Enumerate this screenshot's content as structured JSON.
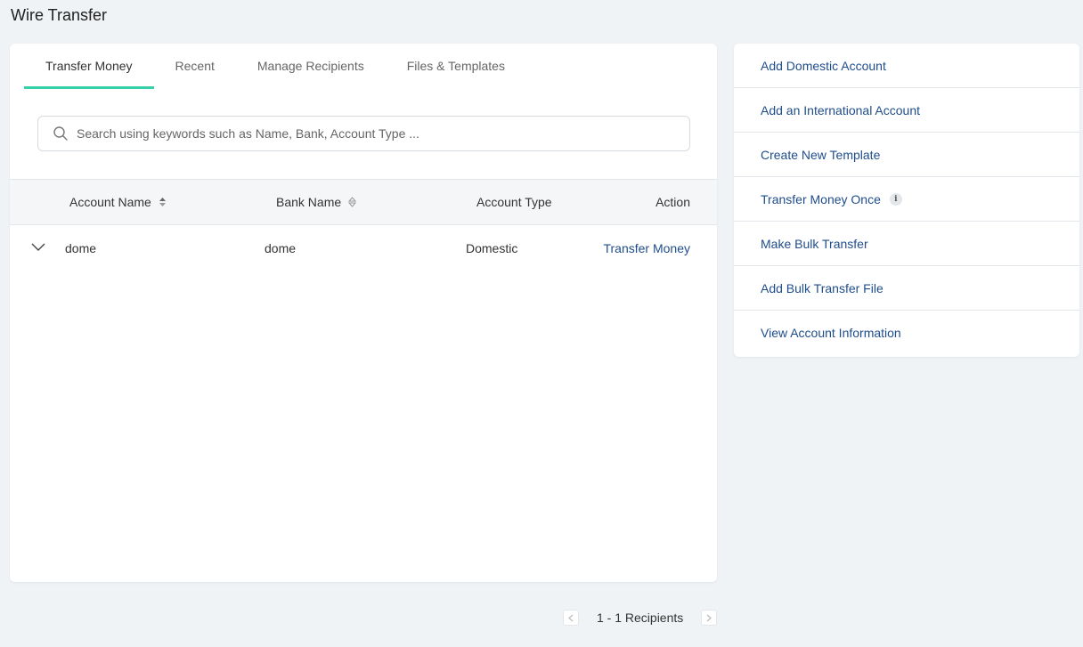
{
  "page": {
    "title": "Wire Transfer"
  },
  "tabs": [
    {
      "label": "Transfer Money",
      "active": true
    },
    {
      "label": "Recent"
    },
    {
      "label": "Manage Recipients"
    },
    {
      "label": "Files & Templates"
    }
  ],
  "search": {
    "placeholder": "Search using keywords such as Name, Bank, Account Type ...",
    "value": ""
  },
  "table": {
    "headers": {
      "account_name": "Account Name",
      "bank_name": "Bank Name",
      "account_type": "Account Type",
      "action": "Action"
    },
    "rows": [
      {
        "account_name": "dome",
        "bank_name": "dome",
        "account_type": "Domestic",
        "action": "Transfer Money"
      }
    ]
  },
  "side_menu": {
    "items": [
      {
        "label": "Add Domestic Account"
      },
      {
        "label": "Add an International Account"
      },
      {
        "label": "Create New Template"
      },
      {
        "label": "Transfer Money Once",
        "info": "i"
      },
      {
        "label": "Make Bulk Transfer"
      },
      {
        "label": "Add Bulk Transfer File"
      },
      {
        "label": "View Account Information"
      }
    ]
  },
  "pagination": {
    "text": "1 - 1 Recipients"
  },
  "colors": {
    "accent": "#35d0a6",
    "link": "#1f4d8c",
    "background": "#f0f3f6"
  },
  "icons": {
    "search": "search-icon",
    "sort": "sort-icon",
    "expand": "chevron-down-icon",
    "info": "info-icon",
    "prev": "chevron-left-icon",
    "next": "chevron-right-icon"
  }
}
